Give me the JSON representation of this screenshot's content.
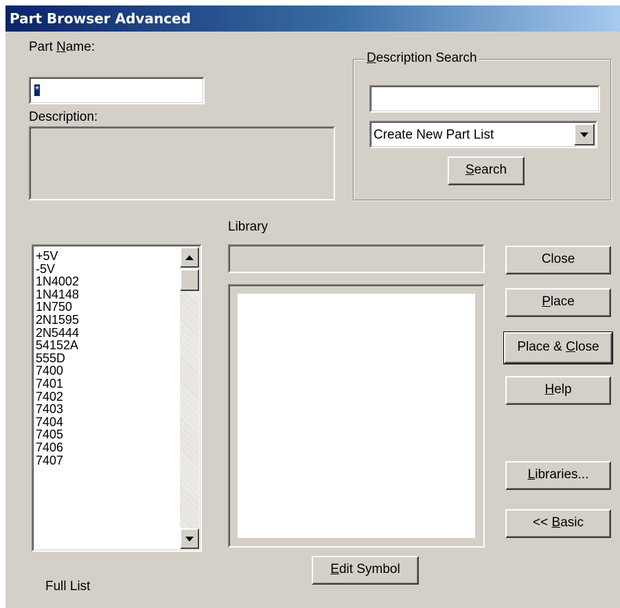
{
  "window": {
    "title": "Part Browser Advanced"
  },
  "part_name": {
    "label_pre": "Part ",
    "label_key": "N",
    "label_post": "ame:",
    "value": "*"
  },
  "description": {
    "label": "Description:",
    "value": ""
  },
  "description_search": {
    "title_key": "D",
    "title_rest": "escription Search",
    "input_value": "",
    "dropdown_selected": "Create New Part List",
    "search_button": {
      "key": "S",
      "rest": "earch"
    }
  },
  "library": {
    "label": "Library",
    "value": ""
  },
  "parts": [
    "+5V",
    "-5V",
    "1N4002",
    "1N4148",
    "1N750",
    "2N1595",
    "2N5444",
    "54152A",
    "555D",
    "7400",
    "7401",
    "7402",
    "7403",
    "7404",
    "7405",
    "7406",
    "7407"
  ],
  "buttons": {
    "close": "Close",
    "place": {
      "key": "P",
      "rest": "lace"
    },
    "place_close": {
      "pre": "Place & ",
      "key": "C",
      "rest": "lose"
    },
    "help": {
      "key": "H",
      "rest": "elp"
    },
    "libraries": {
      "key": "L",
      "rest": "ibraries..."
    },
    "basic": {
      "pre": "<< ",
      "key": "B",
      "rest": "asic"
    },
    "edit_symbol": {
      "key": "E",
      "rest": "dit Symbol"
    }
  },
  "list_filter_label": "Full List"
}
